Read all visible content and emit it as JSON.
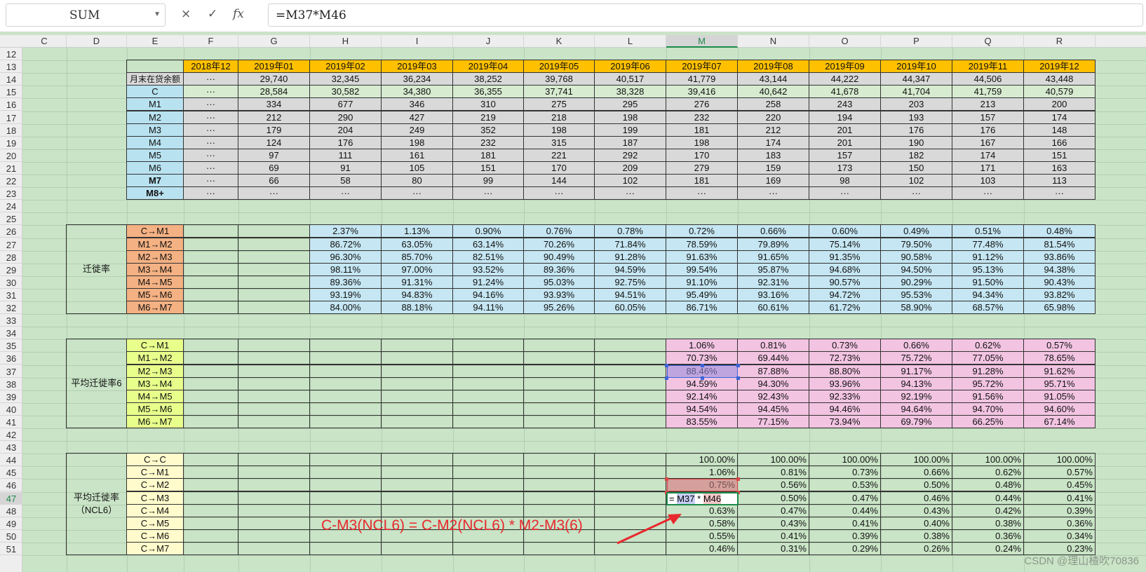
{
  "formula_bar": {
    "name_box": "SUM",
    "cancel_glyph": "×",
    "confirm_glyph": "✓",
    "fx_label": "fx",
    "formula": "=M37*M46"
  },
  "columns": [
    "C",
    "D",
    "E",
    "F",
    "G",
    "H",
    "I",
    "J",
    "K",
    "L",
    "M",
    "N",
    "O",
    "P",
    "Q",
    "R"
  ],
  "selected_column": "M",
  "rows": [
    "12",
    "13",
    "14",
    "15",
    "16",
    "17",
    "18",
    "19",
    "20",
    "21",
    "22",
    "23",
    "24",
    "25",
    "26",
    "27",
    "28",
    "29",
    "30",
    "31",
    "32",
    "33",
    "34",
    "35",
    "36",
    "37",
    "38",
    "39",
    "40",
    "41",
    "42",
    "43",
    "44",
    "45",
    "46",
    "47",
    "48",
    "49",
    "50",
    "51"
  ],
  "selected_row": "47",
  "month_headers": [
    "2018年12",
    "2019年01",
    "2019年02",
    "2019年03",
    "2019年04",
    "2019年05",
    "2019年06",
    "2019年07",
    "2019年08",
    "2019年09",
    "2019年10",
    "2019年11",
    "2019年12"
  ],
  "balance_table": [
    {
      "label": "月末在贷余额",
      "bold": false,
      "values": [
        "···",
        "29,740",
        "32,345",
        "36,234",
        "38,252",
        "39,768",
        "40,517",
        "41,779",
        "43,144",
        "44,222",
        "44,347",
        "44,506",
        "43,448"
      ]
    },
    {
      "label": "C",
      "bold": false,
      "values": [
        "···",
        "28,584",
        "30,582",
        "34,380",
        "36,355",
        "37,741",
        "38,328",
        "39,416",
        "40,642",
        "41,678",
        "41,704",
        "41,759",
        "40,579"
      ]
    },
    {
      "label": "M1",
      "bold": false,
      "values": [
        "···",
        "334",
        "677",
        "346",
        "310",
        "275",
        "295",
        "276",
        "258",
        "243",
        "203",
        "213",
        "200"
      ]
    },
    {
      "label": "M2",
      "bold": false,
      "values": [
        "···",
        "212",
        "290",
        "427",
        "219",
        "218",
        "198",
        "232",
        "220",
        "194",
        "193",
        "157",
        "174"
      ]
    },
    {
      "label": "M3",
      "bold": false,
      "values": [
        "···",
        "179",
        "204",
        "249",
        "352",
        "198",
        "199",
        "181",
        "212",
        "201",
        "176",
        "176",
        "148"
      ]
    },
    {
      "label": "M4",
      "bold": false,
      "values": [
        "···",
        "124",
        "176",
        "198",
        "232",
        "315",
        "187",
        "198",
        "174",
        "201",
        "190",
        "167",
        "166"
      ]
    },
    {
      "label": "M5",
      "bold": false,
      "values": [
        "···",
        "97",
        "111",
        "161",
        "181",
        "221",
        "292",
        "170",
        "183",
        "157",
        "182",
        "174",
        "151"
      ]
    },
    {
      "label": "M6",
      "bold": false,
      "values": [
        "···",
        "69",
        "91",
        "105",
        "151",
        "170",
        "209",
        "279",
        "159",
        "173",
        "150",
        "171",
        "163"
      ]
    },
    {
      "label": "M7",
      "bold": true,
      "values": [
        "···",
        "66",
        "58",
        "80",
        "99",
        "144",
        "102",
        "181",
        "169",
        "98",
        "102",
        "103",
        "113"
      ]
    },
    {
      "label": "M8+",
      "bold": true,
      "values": [
        "···",
        "···",
        "···",
        "···",
        "···",
        "···",
        "···",
        "···",
        "···",
        "···",
        "···",
        "···",
        "···"
      ]
    }
  ],
  "migration": {
    "title": "迁徙率",
    "rows": [
      {
        "label": "C→M1",
        "values": [
          "2.37%",
          "1.13%",
          "0.90%",
          "0.76%",
          "0.78%",
          "0.72%",
          "0.66%",
          "0.60%",
          "0.49%",
          "0.51%",
          "0.48%"
        ]
      },
      {
        "label": "M1→M2",
        "values": [
          "86.72%",
          "63.05%",
          "63.14%",
          "70.26%",
          "71.84%",
          "78.59%",
          "79.89%",
          "75.14%",
          "79.50%",
          "77.48%",
          "81.54%"
        ]
      },
      {
        "label": "M2→M3",
        "values": [
          "96.30%",
          "85.70%",
          "82.51%",
          "90.49%",
          "91.28%",
          "91.63%",
          "91.65%",
          "91.35%",
          "90.58%",
          "91.12%",
          "93.86%"
        ]
      },
      {
        "label": "M3→M4",
        "values": [
          "98.11%",
          "97.00%",
          "93.52%",
          "89.36%",
          "94.59%",
          "99.54%",
          "95.87%",
          "94.68%",
          "94.50%",
          "95.13%",
          "94.38%"
        ]
      },
      {
        "label": "M4→M5",
        "values": [
          "89.36%",
          "91.31%",
          "91.24%",
          "95.03%",
          "92.75%",
          "91.10%",
          "92.31%",
          "90.57%",
          "90.29%",
          "91.50%",
          "90.43%"
        ]
      },
      {
        "label": "M5→M6",
        "values": [
          "93.19%",
          "94.83%",
          "94.16%",
          "93.93%",
          "94.51%",
          "95.49%",
          "93.16%",
          "94.72%",
          "95.53%",
          "94.34%",
          "93.82%"
        ]
      },
      {
        "label": "M6→M7",
        "values": [
          "84.00%",
          "88.18%",
          "94.11%",
          "95.26%",
          "60.05%",
          "86.71%",
          "60.61%",
          "61.72%",
          "58.90%",
          "68.57%",
          "65.98%"
        ]
      }
    ]
  },
  "avg_migration": {
    "title": "平均迁徙率6",
    "rows": [
      {
        "label": "C→M1",
        "values": [
          "1.06%",
          "0.81%",
          "0.73%",
          "0.66%",
          "0.62%",
          "0.57%"
        ]
      },
      {
        "label": "M1→M2",
        "values": [
          "70.73%",
          "69.44%",
          "72.73%",
          "75.72%",
          "77.05%",
          "78.65%"
        ]
      },
      {
        "label": "M2→M3",
        "values": [
          "88.46%",
          "87.88%",
          "88.80%",
          "91.17%",
          "91.28%",
          "91.62%"
        ]
      },
      {
        "label": "M3→M4",
        "values": [
          "94.59%",
          "94.30%",
          "93.96%",
          "94.13%",
          "95.72%",
          "95.71%"
        ]
      },
      {
        "label": "M4→M5",
        "values": [
          "92.14%",
          "92.43%",
          "92.33%",
          "92.19%",
          "91.56%",
          "91.05%"
        ]
      },
      {
        "label": "M5→M6",
        "values": [
          "94.54%",
          "94.45%",
          "94.46%",
          "94.64%",
          "94.70%",
          "94.60%"
        ]
      },
      {
        "label": "M6→M7",
        "values": [
          "83.55%",
          "77.15%",
          "73.94%",
          "69.79%",
          "66.25%",
          "67.14%"
        ]
      }
    ]
  },
  "ncl": {
    "title_line1": "平均迁徙率",
    "title_line2": "（NCL6）",
    "rows": [
      {
        "label": "C→C",
        "values": [
          "100.00%",
          "100.00%",
          "100.00%",
          "100.00%",
          "100.00%",
          "100.00%"
        ]
      },
      {
        "label": "C→M1",
        "values": [
          "1.06%",
          "0.81%",
          "0.73%",
          "0.66%",
          "0.62%",
          "0.57%"
        ]
      },
      {
        "label": "C→M2",
        "values": [
          "0.75%",
          "0.56%",
          "0.53%",
          "0.50%",
          "0.48%",
          "0.45%"
        ]
      },
      {
        "label": "C→M3",
        "values": [
          "",
          "0.50%",
          "0.47%",
          "0.46%",
          "0.44%",
          "0.41%"
        ]
      },
      {
        "label": "C→M4",
        "values": [
          "0.63%",
          "0.47%",
          "0.44%",
          "0.43%",
          "0.42%",
          "0.39%"
        ]
      },
      {
        "label": "C→M5",
        "values": [
          "0.58%",
          "0.43%",
          "0.41%",
          "0.40%",
          "0.38%",
          "0.36%"
        ]
      },
      {
        "label": "C→M6",
        "values": [
          "0.55%",
          "0.41%",
          "0.39%",
          "0.38%",
          "0.36%",
          "0.34%"
        ]
      },
      {
        "label": "C→M7",
        "values": [
          "0.46%",
          "0.31%",
          "0.29%",
          "0.26%",
          "0.24%",
          "0.23%"
        ]
      }
    ]
  },
  "in_cell_edit": {
    "prefix": "= ",
    "ref1": "M37",
    "op": " * ",
    "ref2": "M46"
  },
  "annotation": "C-M3(NCL6) = C-M2(NCL6) * M2-M3(6)",
  "annotation_color": "#e8282d",
  "watermark": "CSDN @理山楂吹70836"
}
